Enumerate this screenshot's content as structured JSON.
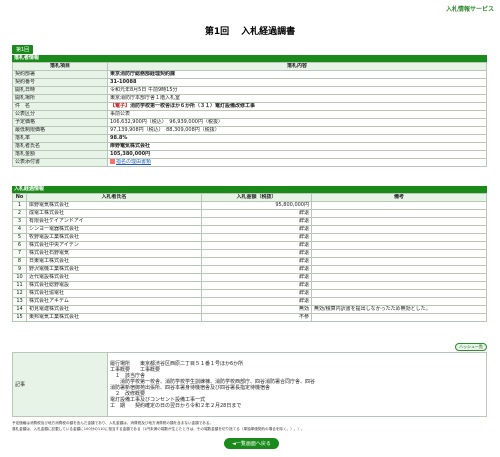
{
  "topnav_label": "入札情報サービス",
  "title_round": "第1回",
  "title_text": "入札経過調書",
  "round_tab": "第1回",
  "info": {
    "header": "落札者情報",
    "col_item": "落札項目",
    "col_content": "落札内容",
    "rows": [
      {
        "label": "契約部署",
        "value": "東京消防庁総務部経理契約課",
        "style": "bold"
      },
      {
        "label": "契約番号",
        "value": "31-10088",
        "style": "bold"
      },
      {
        "label": "開札日時",
        "value": "令和元年8月5日 午前9時15分",
        "style": ""
      },
      {
        "label": "開札場所",
        "value": "東京消防庁本部庁舎１階入札室",
        "style": ""
      },
      {
        "label": "件　名",
        "value_prefix": "【電子】",
        "value": "消防学校第一校舎ほか６か所（３１）電灯設備改修工事",
        "style": "subject"
      },
      {
        "label": "公表区分",
        "value": "事前公表",
        "style": ""
      },
      {
        "label": "予定価格",
        "value": "106,632,900円（税込）　96,939,000円（税抜）",
        "style": ""
      },
      {
        "label": "最低制限価格",
        "value": "97,139,908円（税込）　88,309,008円（税抜）",
        "style": ""
      },
      {
        "label": "落札率",
        "value": "98.8%",
        "style": "bold"
      },
      {
        "label": "落札者氏名",
        "value": "岸野電気株式会社",
        "style": "bold"
      },
      {
        "label": "落札金額",
        "value": "105,380,000円",
        "style": "bold"
      },
      {
        "label": "公表添付書",
        "value": "指名の理由書類",
        "style": "attach"
      }
    ]
  },
  "bidding": {
    "header": "入札経過情報",
    "col_no": "No",
    "col_name": "入札者氏名",
    "col_amount": "入札金額（税抜）",
    "col_remarks": "備考",
    "rows": [
      {
        "no": "1",
        "name": "岸野電気株式会社",
        "amount": "95,800,000円",
        "remarks": ""
      },
      {
        "no": "2",
        "name": "成電工株式会社",
        "amount": "辞退",
        "remarks": ""
      },
      {
        "no": "3",
        "name": "有限会社ケイアンドアイ",
        "amount": "辞退",
        "remarks": ""
      },
      {
        "no": "4",
        "name": "シンヨー電器株式会社",
        "amount": "辞退",
        "remarks": ""
      },
      {
        "no": "5",
        "name": "牧野電設工業株式会社",
        "amount": "辞退",
        "remarks": ""
      },
      {
        "no": "6",
        "name": "株式会社中央アイデン",
        "amount": "辞退",
        "remarks": ""
      },
      {
        "no": "7",
        "name": "株式会社石野電気",
        "amount": "辞退",
        "remarks": ""
      },
      {
        "no": "8",
        "name": "日東電工株式会社",
        "amount": "辞退",
        "remarks": ""
      },
      {
        "no": "9",
        "name": "野沢電機工業株式会社",
        "amount": "辞退",
        "remarks": ""
      },
      {
        "no": "10",
        "name": "近代電設株式会社",
        "amount": "辞退",
        "remarks": ""
      },
      {
        "no": "11",
        "name": "株式会社総野電設",
        "amount": "辞退",
        "remarks": ""
      },
      {
        "no": "12",
        "name": "株式会社協電社",
        "amount": "辞退",
        "remarks": ""
      },
      {
        "no": "13",
        "name": "株式会社アキデム",
        "amount": "辞退",
        "remarks": ""
      },
      {
        "no": "14",
        "name": "初見電建株式会社",
        "amount": "無効",
        "remarks": "無効/積算内訳書を提出しなかったため無効とした。"
      },
      {
        "no": "15",
        "name": "東邦電気工業株式会社",
        "amount": "不参",
        "remarks": ""
      }
    ]
  },
  "sort_button": "ハッシュ一覧",
  "remark": {
    "label": "記事",
    "text": "履行場所　　東京都渋谷区西原二丁目５１番１号ほか6か所\n工事概要　　工事概要\n　１　該当庁舎\n　　消防学校第一校舎、消防学校学生訓練棟、消防学校西部庁、四谷消防署合同庁舎、四谷\n消防署新宿御苑出張所、四谷本署身待機宿舎及び四谷署長指定待機宿舎\n　２　改修概要\n電灯設備工事及びコンセント設備工事一式\n工　期　　契約確定の日の翌日から令和２年２月28日まで"
  },
  "notes": [
    "予定価格は消費税及び地方消費税の額を含んだ金額であり、入札金額は、消費税及び地方消費税の額を含まない金額である。",
    "落札金額は、入札金額に記載している金額に100分の110に相当する金額である（1円未満の端数が生じたときは、その端数金額を切り捨てる（単独単価契約の場合を除く。）。）。"
  ],
  "back_button": "◄一覧画面へ戻る"
}
